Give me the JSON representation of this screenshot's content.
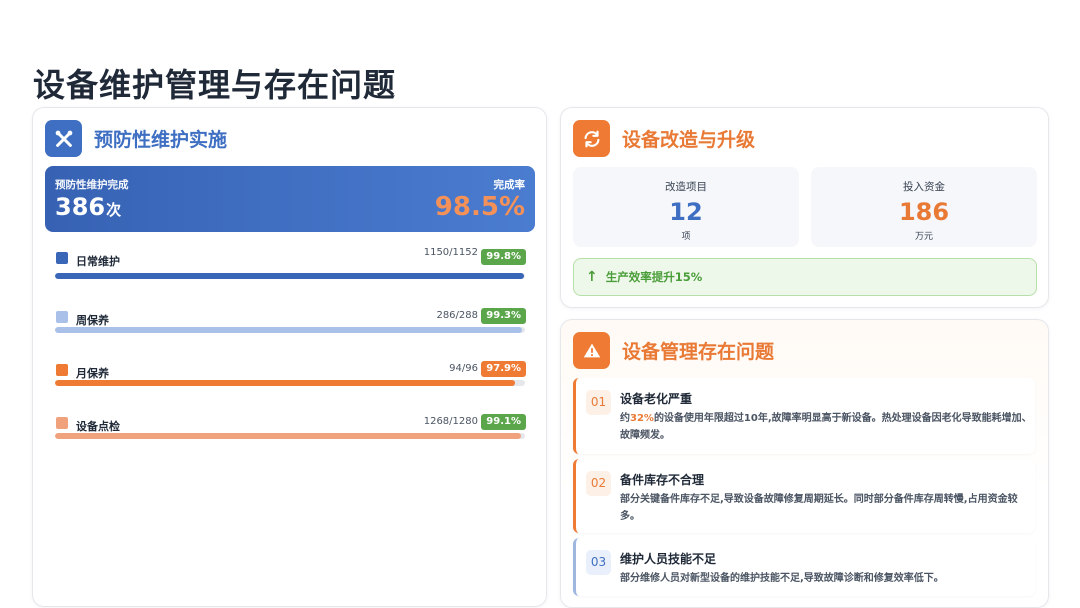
{
  "page": {
    "title": "设备维护管理与存在问题"
  },
  "preventive": {
    "title": "预防性维护实施",
    "icon": "wrench-icon",
    "banner": {
      "label": "预防性维护完成",
      "value": "386",
      "unit": "次",
      "rate_label": "完成率",
      "rate_value": "98.5%"
    },
    "items": [
      {
        "label": "日常维护",
        "count": "1150/1152",
        "pct": "99.8%",
        "progress": 99.8,
        "icon": "calendar-icon",
        "bar_color": "#3a66b8",
        "badge_color": "#5ba64b"
      },
      {
        "label": "周保养",
        "count": "286/288",
        "pct": "99.3%",
        "progress": 99.3,
        "icon": "calendar-week-icon",
        "bar_color": "#a9c0e8",
        "badge_color": "#5ba64b"
      },
      {
        "label": "月保养",
        "count": "94/96",
        "pct": "97.9%",
        "progress": 97.9,
        "icon": "calendar-month-icon",
        "bar_color": "#ee7a33",
        "badge_color": "#ee7a33"
      },
      {
        "label": "设备点检",
        "count": "1268/1280",
        "pct": "99.1%",
        "progress": 99.1,
        "icon": "checklist-icon",
        "bar_color": "#f0a27c",
        "badge_color": "#5ba64b"
      }
    ]
  },
  "upgrade": {
    "title": "设备改造与升级",
    "icon": "refresh-icon",
    "stats": [
      {
        "label": "改造项目",
        "value": "12",
        "unit": "项",
        "color": "#3f6fc2"
      },
      {
        "label": "投入资金",
        "value": "186",
        "unit": "万元",
        "color": "#e97a36"
      }
    ],
    "note": "生产效率提升15%"
  },
  "issues": {
    "title": "设备管理存在问题",
    "icon": "warning-icon",
    "items": [
      {
        "num": "01",
        "title": "设备老化严重",
        "desc_prefix": "约",
        "desc_highlight": "32%",
        "desc": "的设备使用年限超过10年,故障率明显高于新设备。热处理设备因老化导致能耗增加、故障频发。"
      },
      {
        "num": "02",
        "title": "备件库存不合理",
        "desc": "部分关键备件库存不足,导致设备故障修复周期延长。同时部分备件库存周转慢,占用资金较多。"
      },
      {
        "num": "03",
        "title": "维护人员技能不足",
        "desc": "部分维修人员对新型设备的维护技能不足,导致故障诊断和修复效率低下。"
      }
    ]
  }
}
